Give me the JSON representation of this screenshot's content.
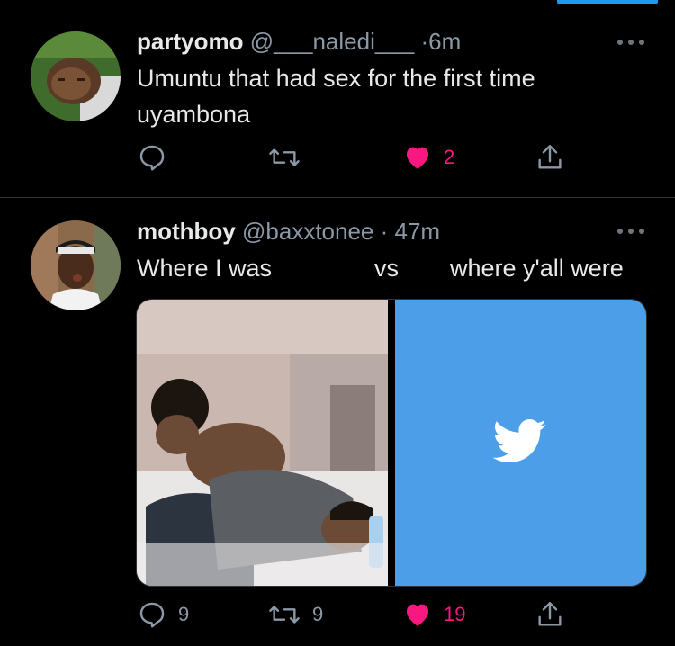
{
  "tweets": [
    {
      "name": "partyomo",
      "handle": "@___naledi___",
      "time": "6m",
      "text_lines": [
        "Umuntu that had sex for the first time",
        "uyambona"
      ],
      "reply_count": "",
      "retweet_count": "",
      "like_count": "2"
    },
    {
      "name": "mothboy",
      "handle": "@baxxtonee",
      "time": "47m",
      "text_parts": [
        "Where I was",
        "vs",
        "where y'all were"
      ],
      "reply_count": "9",
      "retweet_count": "9",
      "like_count": "19"
    }
  ],
  "icons": {
    "more": "more-dots-icon",
    "reply": "reply-bubble-icon",
    "retweet": "retweet-icon",
    "like": "heart-icon",
    "share": "share-icon",
    "media_logo": "twitter-bird-icon"
  },
  "colors": {
    "accent": "#1d9bf0",
    "like": "#f91880",
    "muted": "#8b98a5",
    "media_blue": "#4c9ee8"
  }
}
